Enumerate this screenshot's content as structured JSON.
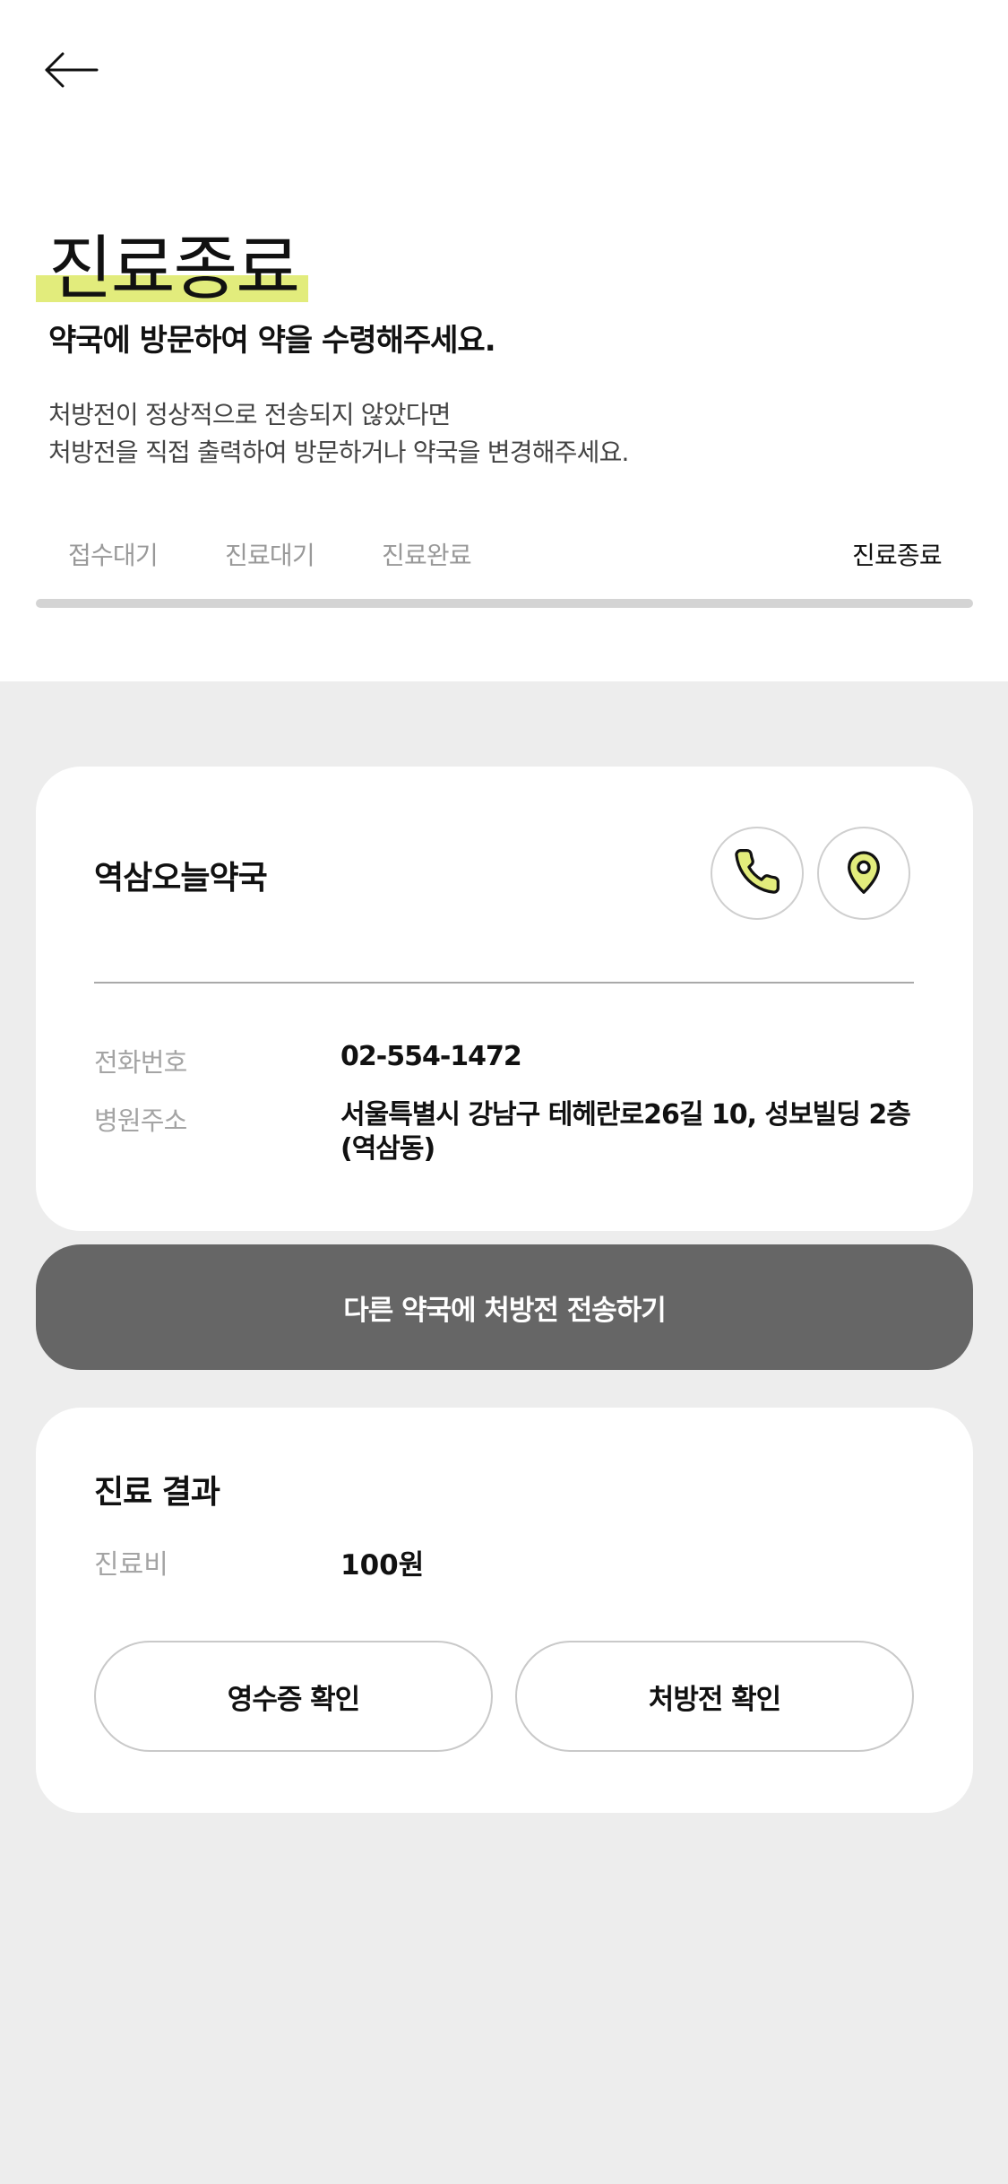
{
  "header": {
    "back_icon": "arrow-left-icon",
    "title": "진료종료",
    "subtitle": "약국에 방문하여 약을 수령해주세요.",
    "description_lines": [
      "처방전이 정상적으로 전송되지 않았다면",
      "처방전을 직접 출력하여 방문하거나 약국을 변경해주세요."
    ],
    "highlight_color": "#e2ec7c"
  },
  "steps": [
    {
      "label": "접수대기",
      "active": false
    },
    {
      "label": "진료대기",
      "active": false
    },
    {
      "label": "진료완료",
      "active": false
    },
    {
      "label": "진료종료",
      "active": true
    }
  ],
  "pharmacy": {
    "name": "역삼오늘약국",
    "call_icon": "phone-icon",
    "map_icon": "map-pin-icon",
    "icon_color": "#e2ec7c",
    "phone_label": "전화번호",
    "phone_value": "02-554-1472",
    "address_label": "병원주소",
    "address_value": "서울특별시 강남구 테헤란로26길 10, 성보빌딩 2층 (역삼동)"
  },
  "send_button": {
    "label": "다른 약국에 처방전 전송하기",
    "color": "#666666"
  },
  "result": {
    "title": "진료 결과",
    "fee_label": "진료비",
    "fee_value": "100원",
    "receipt_button": "영수증 확인",
    "prescription_button": "처방전 확인"
  }
}
